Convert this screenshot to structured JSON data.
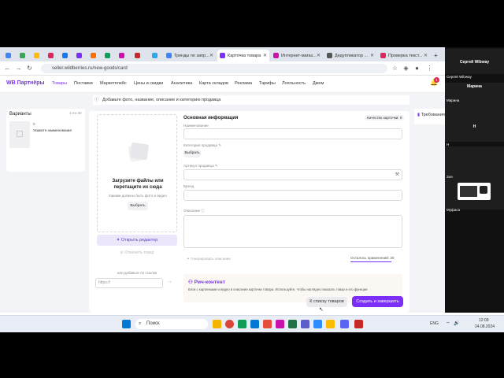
{
  "browser": {
    "tabs": [
      {
        "label": "Тренды по запр...",
        "color": "#4285f4"
      },
      {
        "label": "Карточка товара",
        "color": "#7b2ff7",
        "active": true
      },
      {
        "label": "Интернет-магаз...",
        "color": "#cb11ab"
      },
      {
        "label": "Дедупликатор ...",
        "color": "#555555"
      },
      {
        "label": "Проверка текст...",
        "color": "#e0245e"
      }
    ],
    "new_tab": "+",
    "url": "seller.wildberries.ru/new-goods/card"
  },
  "header": {
    "logo": "WB Партнёры",
    "menu": [
      "Товары",
      "Поставки",
      "Маркетплейс",
      "Цены и скидки",
      "Аналитика",
      "Карта складов",
      "Реклама",
      "Тарифы",
      "Лояльность",
      "Джем"
    ],
    "bell_badge": "1"
  },
  "notice": "Добавьте фото, название, описание и категорию продавца",
  "variants": {
    "title": "Варианты",
    "count": "1 из 30",
    "item_index": "0",
    "item_name": "Укажите наименование"
  },
  "upload": {
    "title": "Загрузите файлы или перетащите их сюда",
    "hint": "Какими должны быть фото и видео",
    "choose": "Выбрать",
    "open_editor": "Открыть редактор",
    "remove": "Отменить товар",
    "by_link": "или добавьте по ссылке",
    "link_placeholder": "https://"
  },
  "form": {
    "section": "Основная информация",
    "quality": "Качество карточки: 0",
    "name_label": "Наименование",
    "category_label": "Категория продавца",
    "category_btn": "Выбрать",
    "article_label": "Артикул продавца",
    "brand_label": "Бренд",
    "description_label": "Описание",
    "generate": "Генерировать описание",
    "remaining": "Осталось применений: 20"
  },
  "rich": {
    "title": "Рич-контент",
    "desc": "Блок с картинками и видео в описании карточки товара. Используйте, чтобы наглядно показать товар и его функции"
  },
  "footer": {
    "back": "К списку товаров",
    "create": "Создать и завершить"
  },
  "right_panel": "Требования",
  "taskbar": {
    "search": "Поиск",
    "lang": "ENG",
    "time": "12:09",
    "date": "24.08.2024"
  },
  "video": {
    "participants": [
      "Сергей Wibway",
      "Марина",
      "Н",
      "Зоя"
    ],
    "caption": "Муфаса"
  },
  "colors": {
    "accent": "#7b2ff7",
    "create_btn": "#7b2ff7"
  }
}
